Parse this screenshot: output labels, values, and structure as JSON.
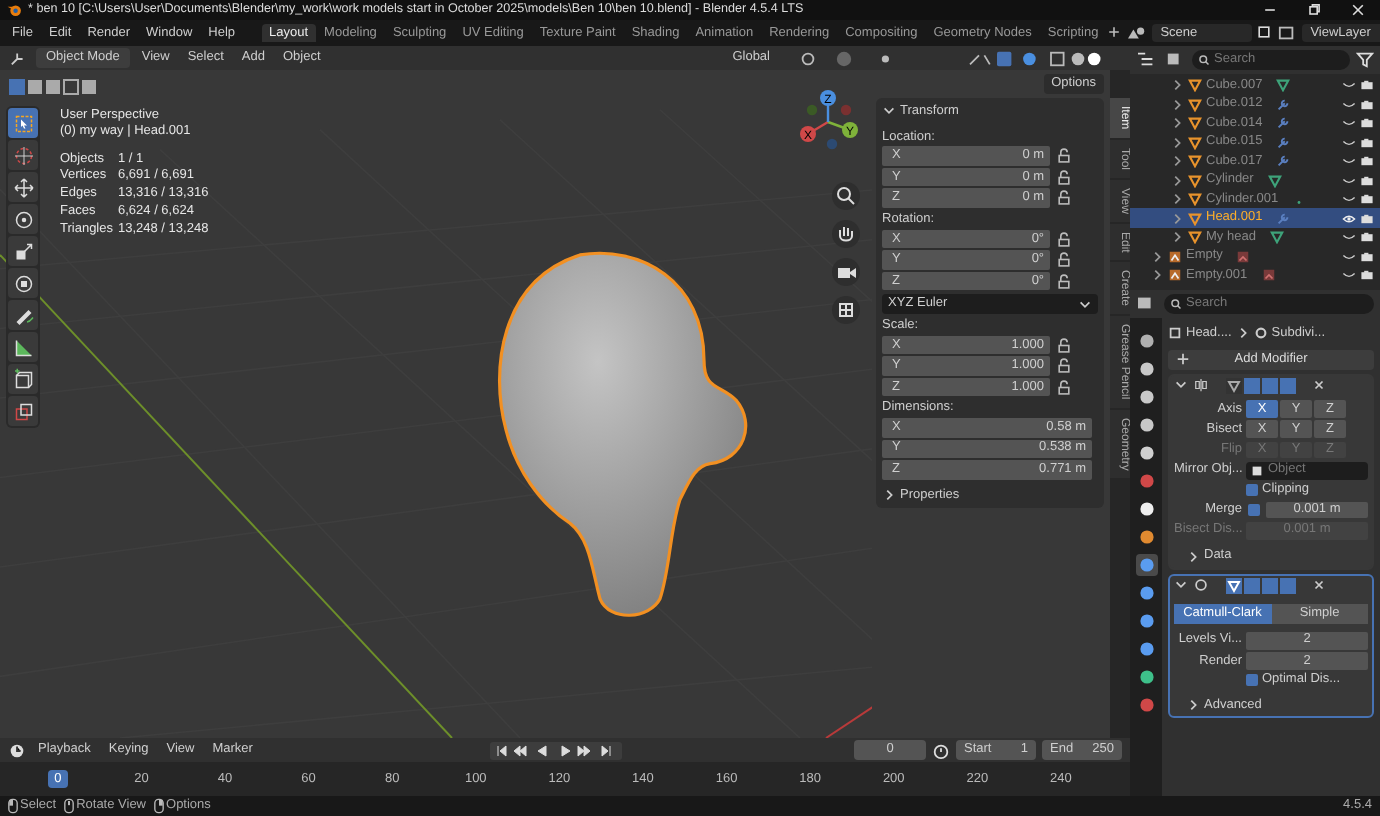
{
  "title_bar": {
    "title": "* ben 10 [C:\\Users\\User\\Documents\\Blender\\my_work\\work models start in October 2025\\models\\Ben 10\\ben 10.blend] - Blender 4.5.4 LTS"
  },
  "menu": [
    "File",
    "Edit",
    "Render",
    "Window",
    "Help"
  ],
  "workspaces": [
    {
      "label": "Layout",
      "selected": true
    },
    {
      "label": "Modeling",
      "selected": false
    },
    {
      "label": "Sculpting",
      "selected": false
    },
    {
      "label": "UV Editing",
      "selected": false
    },
    {
      "label": "Texture Paint",
      "selected": false
    },
    {
      "label": "Shading",
      "selected": false
    },
    {
      "label": "Animation",
      "selected": false
    },
    {
      "label": "Rendering",
      "selected": false
    },
    {
      "label": "Compositing",
      "selected": false
    },
    {
      "label": "Geometry Nodes",
      "selected": false
    },
    {
      "label": "Scripting",
      "selected": false
    }
  ],
  "scene": "Scene",
  "view_layer": "ViewLayer",
  "viewport_header": {
    "mode": "Object Mode",
    "menus": [
      "View",
      "Select",
      "Add",
      "Object"
    ],
    "orientation": "Global"
  },
  "tools": [
    {
      "kind": "select",
      "selected": true
    },
    {
      "kind": "cursor",
      "selected": false
    },
    {
      "kind": "move",
      "selected": false
    },
    {
      "kind": "rotate",
      "selected": false
    },
    {
      "kind": "scale",
      "selected": false
    },
    {
      "kind": "transform",
      "selected": false
    },
    {
      "kind": "annotate",
      "selected": false
    },
    {
      "kind": "measure",
      "selected": false
    },
    {
      "kind": "add-cube",
      "selected": false
    },
    {
      "kind": "cube-extra",
      "selected": false
    }
  ],
  "overlay": {
    "title": "User Perspective",
    "subtitle": "(0) my way | Head.001",
    "stats": [
      {
        "label": "Objects",
        "value": "1 / 1"
      },
      {
        "label": "Vertices",
        "value": "6,691 / 6,691"
      },
      {
        "label": "Edges",
        "value": "13,316 / 13,316"
      },
      {
        "label": "Faces",
        "value": "6,624 / 6,624"
      },
      {
        "label": "Triangles",
        "value": "13,248 / 13,248"
      }
    ]
  },
  "gizmo": {
    "x": "X",
    "y": "Y",
    "z": "Z"
  },
  "n_panel": {
    "options": "Options",
    "tabs": [
      {
        "label": "Item",
        "selected": true
      },
      {
        "label": "Tool",
        "selected": false
      },
      {
        "label": "View",
        "selected": false
      },
      {
        "label": "Edit",
        "selected": false
      },
      {
        "label": "Create",
        "selected": false
      },
      {
        "label": "Grease Pencil",
        "selected": false
      },
      {
        "label": "Geometry",
        "selected": false
      }
    ],
    "transform": {
      "title": "Transform",
      "groups": [
        {
          "label": "Location:",
          "locks": true,
          "fields": [
            {
              "axis": "X",
              "value": "0 m"
            },
            {
              "axis": "Y",
              "value": "0 m"
            },
            {
              "axis": "Z",
              "value": "0 m"
            }
          ]
        },
        {
          "label": "Rotation:",
          "locks": true,
          "mode": "XYZ Euler",
          "fields": [
            {
              "axis": "X",
              "value": "0°"
            },
            {
              "axis": "Y",
              "value": "0°"
            },
            {
              "axis": "Z",
              "value": "0°"
            }
          ]
        },
        {
          "label": "Scale:",
          "locks": true,
          "fields": [
            {
              "axis": "X",
              "value": "1.000"
            },
            {
              "axis": "Y",
              "value": "1.000"
            },
            {
              "axis": "Z",
              "value": "1.000"
            }
          ]
        },
        {
          "label": "Dimensions:",
          "locks": false,
          "fields": [
            {
              "axis": "X",
              "value": "0.58 m"
            },
            {
              "axis": "Y",
              "value": "0.538 m"
            },
            {
              "axis": "Z",
              "value": "0.771 m"
            }
          ]
        }
      ]
    },
    "properties": "Properties"
  },
  "outliner": {
    "search_placeholder": "Search",
    "items": [
      {
        "name": "Cube.007",
        "kind": "mesh",
        "badge": {
          "kind": "mesh"
        },
        "visible": false,
        "selected": false
      },
      {
        "name": "Cube.012",
        "kind": "mesh",
        "badge": {
          "kind": "modifier"
        },
        "visible": false,
        "selected": false
      },
      {
        "name": "Cube.014",
        "kind": "mesh",
        "badge": {
          "kind": "modifier"
        },
        "visible": false,
        "selected": false
      },
      {
        "name": "Cube.015",
        "kind": "mesh",
        "badge": {
          "kind": "modifier"
        },
        "visible": false,
        "selected": false
      },
      {
        "name": "Cube.017",
        "kind": "mesh",
        "badge": {
          "kind": "modifier"
        },
        "visible": false,
        "selected": false
      },
      {
        "name": "Cylinder",
        "kind": "mesh",
        "badge": {
          "kind": "mesh"
        },
        "visible": false,
        "selected": false
      },
      {
        "name": "Cylinder.001",
        "kind": "mesh",
        "badge": {
          "kind": "dot"
        },
        "visible": false,
        "selected": false
      },
      {
        "name": "Head.001",
        "kind": "mesh",
        "badge": {
          "kind": "modifier"
        },
        "visible": true,
        "selected": true
      },
      {
        "name": "My head",
        "kind": "mesh",
        "badge": {
          "kind": "mesh"
        },
        "visible": false,
        "selected": false
      },
      {
        "name": "Empty",
        "kind": "empty",
        "badge": {
          "kind": "image"
        },
        "visible": false,
        "selected": false
      },
      {
        "name": "Empty.001",
        "kind": "empty",
        "badge": {
          "kind": "image"
        },
        "visible": false,
        "selected": false
      }
    ]
  },
  "properties": {
    "search_placeholder": "Search",
    "breadcrumb": [
      "Head....",
      "Subdivi..."
    ],
    "tabs": [
      {
        "kind": "tool",
        "selected": false
      },
      {
        "kind": "render",
        "selected": false
      },
      {
        "kind": "output",
        "selected": false
      },
      {
        "kind": "view_layer",
        "selected": false
      },
      {
        "kind": "scene",
        "selected": false
      },
      {
        "kind": "world",
        "selected": false
      },
      {
        "kind": "collection",
        "selected": false
      },
      {
        "kind": "object",
        "selected": false
      },
      {
        "kind": "modifier",
        "selected": true
      },
      {
        "kind": "particles",
        "selected": false
      },
      {
        "kind": "physics",
        "selected": false
      },
      {
        "kind": "constraints",
        "selected": false
      },
      {
        "kind": "data",
        "selected": false
      },
      {
        "kind": "material",
        "selected": false
      }
    ],
    "add_modifier": "Add Modifier",
    "mirror": {
      "active": false,
      "axis_rows": [
        {
          "label": "Axis",
          "disabled": false,
          "buttons": [
            {
              "label": "X",
              "selected": true
            },
            {
              "label": "Y",
              "selected": false
            },
            {
              "label": "Z",
              "selected": false
            }
          ]
        },
        {
          "label": "Bisect",
          "disabled": false,
          "buttons": [
            {
              "label": "X",
              "selected": false
            },
            {
              "label": "Y",
              "selected": false
            },
            {
              "label": "Z",
              "selected": false
            }
          ]
        },
        {
          "label": "Flip",
          "disabled": true,
          "buttons": [
            {
              "label": "X",
              "selected": false
            },
            {
              "label": "Y",
              "selected": false
            },
            {
              "label": "Z",
              "selected": false
            }
          ]
        }
      ],
      "mirror_object": {
        "label": "Mirror Obj...",
        "placeholder": "Object"
      },
      "clipping": {
        "label": "Clipping",
        "checked": true
      },
      "merge": {
        "label": "Merge",
        "checked": true,
        "value": "0.001 m"
      },
      "bisect_distance": {
        "label": "Bisect Dis...",
        "value": "0.001 m",
        "disabled": true
      },
      "data": {
        "label": "Data",
        "expanded": false
      }
    },
    "subdivision": {
      "active": true,
      "methods": [
        {
          "label": "Catmull-Clark",
          "selected": true
        },
        {
          "label": "Simple",
          "selected": false
        }
      ],
      "levels": [
        {
          "label": "Levels Vi...",
          "value": "2"
        },
        {
          "label": "Render",
          "value": "2"
        }
      ],
      "optimal": {
        "label": "Optimal Dis...",
        "checked": true
      },
      "advanced": {
        "label": "Advanced",
        "expanded": false
      }
    }
  },
  "timeline": {
    "menus": [
      "Playback",
      "Keying",
      "View",
      "Marker"
    ],
    "current_frame": "0",
    "start_label": "Start",
    "start": "1",
    "end_label": "End",
    "end": "250",
    "playhead": "0",
    "ticks": [
      "20",
      "40",
      "60",
      "80",
      "100",
      "120",
      "140",
      "160",
      "180",
      "200",
      "220",
      "240"
    ]
  },
  "status_bar": {
    "hints": [
      {
        "kind": "left",
        "label": "Select"
      },
      {
        "kind": "middle",
        "label": "Rotate View"
      },
      {
        "kind": "right",
        "label": "Options"
      }
    ],
    "version": "4.5.4"
  }
}
